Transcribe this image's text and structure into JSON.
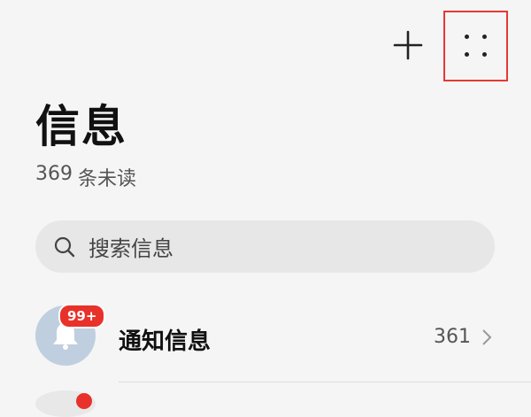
{
  "header": {
    "add_icon": "plus-icon",
    "more_icon": "four-dots-icon"
  },
  "page": {
    "title": "信息",
    "unread_count": "369",
    "unread_label": "条未读"
  },
  "search": {
    "icon": "search-icon",
    "placeholder": "搜索信息"
  },
  "conversations": [
    {
      "avatar_icon": "bell-icon",
      "badge": "99+",
      "title": "通知信息",
      "count": "361",
      "chevron_icon": "chevron-right-icon"
    }
  ],
  "colors": {
    "background": "#f5f5f5",
    "search_background": "#e7e7e7",
    "badge": "#e8312a",
    "highlight_box": "#e53935",
    "avatar": "#bfcfdf"
  }
}
